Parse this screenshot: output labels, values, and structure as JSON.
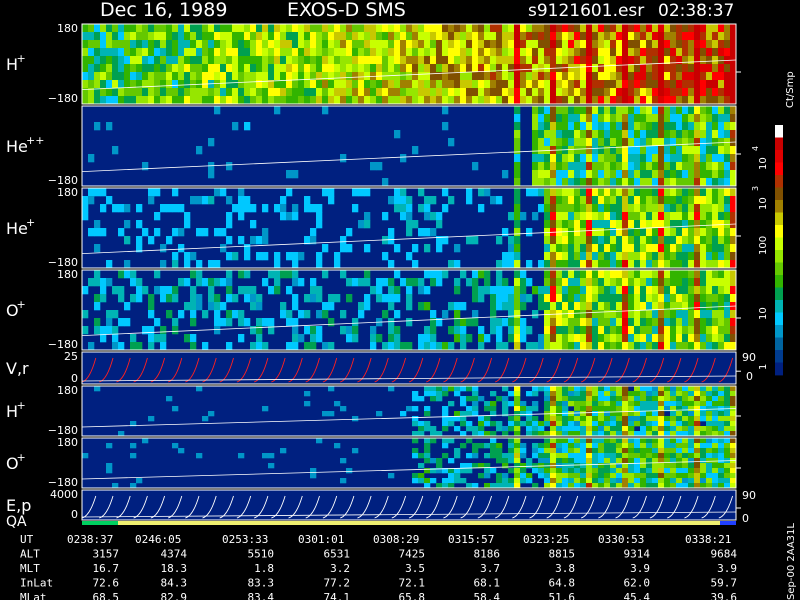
{
  "header": {
    "date": "Dec 16, 1989",
    "instrument": "EXOS-D SMS",
    "file": "s9121601.esr",
    "time": "02:38:37"
  },
  "colorbar": {
    "unit": "Ct/Smp",
    "tick_labels": [
      "10",
      "4",
      "10",
      "3",
      "100",
      "10",
      "1",
      "0"
    ],
    "colors": [
      "#ffffff",
      "#c80000",
      "#e00000",
      "#ff0000",
      "#b03000",
      "#805000",
      "#a08000",
      "#c8c800",
      "#ffff00",
      "#c8ff00",
      "#96e600",
      "#64c800",
      "#32b400",
      "#00a050",
      "#00b4b4",
      "#00c8ff",
      "#0096c8",
      "#0064a0",
      "#003c90",
      "#002080"
    ]
  },
  "panels": [
    {
      "id": "h-plus-1",
      "label": "H",
      "sup": "+",
      "ytop": "180",
      "ybot": "−180",
      "kind": "spec"
    },
    {
      "id": "he-plus-plus",
      "label": "He",
      "sup": "++",
      "ytop": "",
      "ybot": "−180",
      "kind": "spec"
    },
    {
      "id": "he-plus",
      "label": "He",
      "sup": "+",
      "ytop": "180",
      "ybot": "−180",
      "kind": "spec"
    },
    {
      "id": "o-plus-1",
      "label": "O",
      "sup": "+",
      "ytop": "180",
      "ybot": "−180",
      "kind": "spec"
    },
    {
      "id": "v-r",
      "label": "V,r",
      "sup": "",
      "ytop": "25",
      "ybot": "0",
      "right": "90",
      "kind": "line"
    },
    {
      "id": "h-plus-2",
      "label": "H",
      "sup": "+",
      "ytop": "180",
      "ybot": "−180",
      "kind": "spec"
    },
    {
      "id": "o-plus-2",
      "label": "O",
      "sup": "+",
      "ytop": "180",
      "ybot": "−180",
      "kind": "spec"
    },
    {
      "id": "e-p",
      "label": "E,p",
      "sup": "",
      "ytop": "4000",
      "ybot": "0",
      "right": "90",
      "right2": "0",
      "kind": "line"
    }
  ],
  "qa_label": "QA",
  "footer": {
    "rows": [
      {
        "name": "UT",
        "values": [
          "0238:37",
          "0246:05",
          "0253:33",
          "0301:01",
          "0308:29",
          "0315:57",
          "0323:25",
          "0330:53",
          "0338:21"
        ]
      },
      {
        "name": "ALT",
        "values": [
          "3157",
          "4374",
          "5510",
          "6531",
          "7425",
          "8186",
          "8815",
          "9314",
          "9684"
        ]
      },
      {
        "name": "MLT",
        "values": [
          "16.7",
          "18.3",
          "1.8",
          "3.2",
          "3.5",
          "3.7",
          "3.8",
          "3.9",
          "3.9"
        ]
      },
      {
        "name": "InLat",
        "values": [
          "72.6",
          "84.3",
          "83.3",
          "77.2",
          "72.1",
          "68.1",
          "64.8",
          "62.0",
          "59.7"
        ]
      },
      {
        "name": "MLat",
        "values": [
          "68.5",
          "82.9",
          "83.4",
          "74.1",
          "65.8",
          "58.4",
          "51.6",
          "45.4",
          "39.6"
        ]
      }
    ],
    "side_note": "Sep-00  2AA31L"
  },
  "chart_data": {
    "type": "heatmap",
    "title": "Dec 16, 1989   EXOS-D SMS",
    "x": [
      "0238:37",
      "0246:05",
      "0253:33",
      "0301:01",
      "0308:29",
      "0315:57",
      "0323:25",
      "0330:53",
      "0338:21"
    ],
    "series": [
      {
        "name": "H+",
        "ylim": [
          -180,
          180
        ]
      },
      {
        "name": "He++",
        "ylim": [
          -180,
          180
        ]
      },
      {
        "name": "He+",
        "ylim": [
          -180,
          180
        ]
      },
      {
        "name": "O+",
        "ylim": [
          -180,
          180
        ]
      },
      {
        "name": "V,r",
        "ylim": [
          0,
          25
        ]
      },
      {
        "name": "H+",
        "ylim": [
          -180,
          180
        ]
      },
      {
        "name": "O+",
        "ylim": [
          -180,
          180
        ]
      },
      {
        "name": "E,p",
        "ylim": [
          0,
          4000
        ]
      }
    ],
    "colorbar_range": [
      1,
      10000
    ],
    "colorbar_scale": "log"
  }
}
